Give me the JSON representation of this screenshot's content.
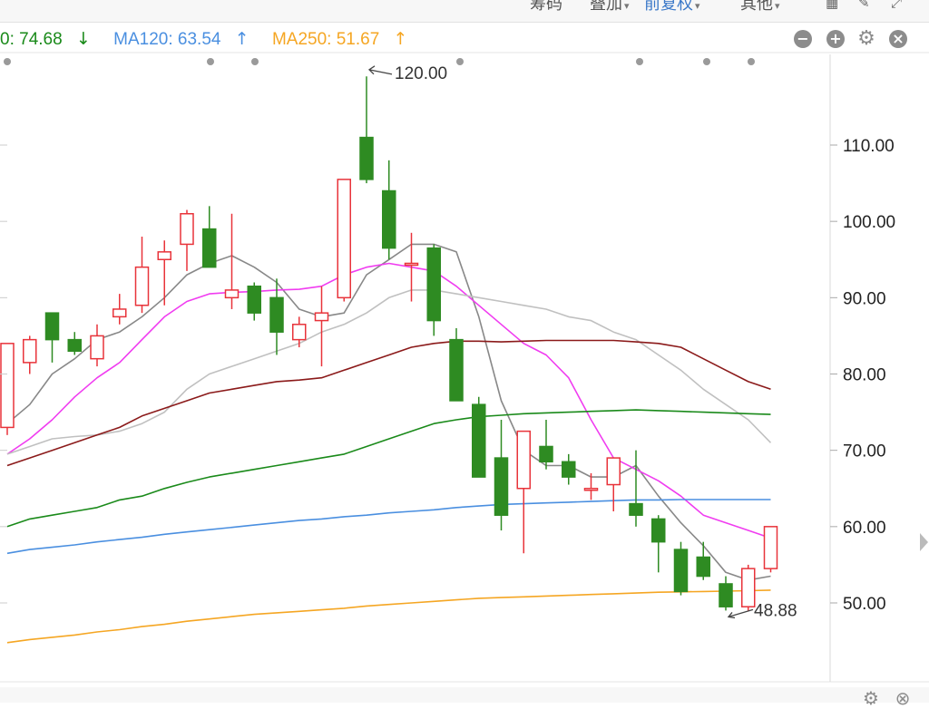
{
  "toolbar": {
    "items": [
      {
        "label": "筹码",
        "caret": false,
        "active": false
      },
      {
        "label": "叠加",
        "caret": true,
        "active": false
      },
      {
        "label": "前复权",
        "caret": true,
        "active": true
      },
      {
        "label": "其他",
        "caret": true,
        "active": false
      }
    ],
    "icons": [
      "layout-icon",
      "pen-icon",
      "fullscreen-icon"
    ]
  },
  "legend": [
    {
      "text": "0: 74.68",
      "arrow": "↓",
      "color": "#1a8a1a"
    },
    {
      "text": "MA120: 63.54",
      "arrow": "↑",
      "color": "#4a8fe0"
    },
    {
      "text": "MA250: 51.67",
      "arrow": "↑",
      "color": "#f5a623"
    }
  ],
  "panel_controls": [
    "minus-icon",
    "plus-icon",
    "gear-icon",
    "close-icon"
  ],
  "colors": {
    "up": "#e8333a",
    "down": "#2e8b22",
    "ma5": "#888888",
    "ma10": "#f03cf0",
    "ma20": "#c0c0c0",
    "ma30": "#8b1a1a",
    "ma60": "#1a8a1a",
    "ma120": "#4a8fe0",
    "ma250": "#f5a623"
  },
  "chart_data": {
    "type": "candlestick",
    "y_ticks": [
      "110.00",
      "100.00",
      "90.00",
      "80.00",
      "70.00",
      "60.00",
      "50.00"
    ],
    "y_tick_values": [
      110,
      100,
      90,
      80,
      70,
      60,
      50
    ],
    "ylim": [
      41,
      126
    ],
    "max_label": "120.00",
    "max_value": 120.0,
    "min_label": "48.88",
    "min_value": 48.88,
    "candles": [
      {
        "o": 73,
        "h": 84,
        "l": 72,
        "c": 84
      },
      {
        "o": 81.5,
        "h": 85,
        "l": 80,
        "c": 84.5
      },
      {
        "o": 88,
        "h": 88,
        "l": 81.5,
        "c": 84.5
      },
      {
        "o": 84.5,
        "h": 85.5,
        "l": 82.5,
        "c": 83
      },
      {
        "o": 82,
        "h": 86.5,
        "l": 81,
        "c": 85
      },
      {
        "o": 87.5,
        "h": 90.5,
        "l": 86.5,
        "c": 88.5
      },
      {
        "o": 89,
        "h": 98,
        "l": 88,
        "c": 94
      },
      {
        "o": 95,
        "h": 97.5,
        "l": 89,
        "c": 96
      },
      {
        "o": 97,
        "h": 101.5,
        "l": 93.5,
        "c": 101
      },
      {
        "o": 99,
        "h": 102,
        "l": 94,
        "c": 94
      },
      {
        "o": 90,
        "h": 101,
        "l": 88.5,
        "c": 91
      },
      {
        "o": 91.5,
        "h": 92,
        "l": 87,
        "c": 88
      },
      {
        "o": 90,
        "h": 92.5,
        "l": 82.5,
        "c": 85.5
      },
      {
        "o": 84.5,
        "h": 87.5,
        "l": 83.5,
        "c": 86.5
      },
      {
        "o": 87,
        "h": 91.5,
        "l": 81,
        "c": 88
      },
      {
        "o": 90,
        "h": 91,
        "l": 89.5,
        "c": 105.5
      },
      {
        "o": 111,
        "h": 119,
        "l": 105,
        "c": 105.5
      },
      {
        "o": 104,
        "h": 108,
        "l": 95,
        "c": 96.5
      },
      {
        "o": 94.5,
        "h": 98.5,
        "l": 89.5,
        "c": 94.5
      },
      {
        "o": 96.5,
        "h": 97,
        "l": 85,
        "c": 87
      },
      {
        "o": 84.5,
        "h": 86,
        "l": 77.5,
        "c": 76.5
      },
      {
        "o": 76,
        "h": 77,
        "l": 66.5,
        "c": 66.5
      },
      {
        "o": 69,
        "h": 74,
        "l": 59.5,
        "c": 61.5
      },
      {
        "o": 65,
        "h": 72.5,
        "l": 56.5,
        "c": 72.5
      },
      {
        "o": 70.5,
        "h": 74,
        "l": 67.5,
        "c": 68.5
      },
      {
        "o": 68.5,
        "h": 69.5,
        "l": 65.5,
        "c": 66.5
      },
      {
        "o": 65,
        "h": 67,
        "l": 63.5,
        "c": 65
      },
      {
        "o": 65.5,
        "h": 69,
        "l": 62,
        "c": 69
      },
      {
        "o": 63,
        "h": 70,
        "l": 60,
        "c": 61.5
      },
      {
        "o": 61,
        "h": 61.5,
        "l": 54,
        "c": 58
      },
      {
        "o": 57,
        "h": 58,
        "l": 51,
        "c": 51.5
      },
      {
        "o": 56,
        "h": 58,
        "l": 53,
        "c": 53.5
      },
      {
        "o": 52.5,
        "h": 53.5,
        "l": 49,
        "c": 49.5
      },
      {
        "o": 49.5,
        "h": 55,
        "l": 49,
        "c": 54.5
      },
      {
        "o": 54.5,
        "h": 60,
        "l": 54,
        "c": 60
      }
    ],
    "ma_lines": [
      {
        "name": "MA5",
        "color_key": "ma5",
        "values": [
          73.5,
          76,
          80,
          82,
          84.5,
          85.5,
          87.5,
          90,
          93,
          94.5,
          95.5,
          94,
          92,
          88.5,
          87.5,
          88,
          93,
          95,
          97,
          97,
          96,
          87.5,
          76.5,
          70,
          68,
          68,
          66.5,
          66.5,
          68,
          64,
          60.5,
          57.5,
          54,
          53,
          53.5
        ]
      },
      {
        "name": "MA10",
        "color_key": "ma10",
        "values": [
          69.5,
          71.5,
          74,
          77,
          79.5,
          81.5,
          84.5,
          87.5,
          89.5,
          90.5,
          90.7,
          90.8,
          91,
          91.1,
          91.5,
          93,
          94,
          94.5,
          94,
          93.5,
          91.5,
          89,
          86.5,
          84,
          82.5,
          79.5,
          74,
          69,
          67.5,
          66,
          64,
          61.5,
          60.5,
          59.5,
          58.5
        ]
      },
      {
        "name": "MA20",
        "color_key": "ma20",
        "values": [
          69.5,
          70.5,
          71.5,
          71.8,
          72,
          72.5,
          73.5,
          75,
          78,
          80,
          81,
          82,
          83,
          84,
          85.5,
          86.5,
          88,
          90,
          91,
          91,
          90.5,
          90,
          89.5,
          89,
          88.5,
          87.5,
          87,
          85.5,
          84.5,
          82.5,
          80.5,
          78,
          76,
          74,
          71
        ]
      },
      {
        "name": "MA30",
        "color_key": "ma30",
        "values": [
          68,
          69,
          70,
          71,
          72,
          73,
          74.5,
          75.5,
          76.5,
          77.5,
          78,
          78.5,
          79,
          79.2,
          79.5,
          80.5,
          81.5,
          82.5,
          83.5,
          84,
          84.3,
          84.3,
          84.2,
          84.3,
          84.4,
          84.4,
          84.4,
          84.4,
          84.2,
          84,
          83.5,
          82,
          80.5,
          79,
          78
        ]
      },
      {
        "name": "MA60",
        "color_key": "ma60",
        "values": [
          60,
          61,
          61.5,
          62,
          62.5,
          63.5,
          64,
          65,
          65.8,
          66.5,
          67,
          67.5,
          68,
          68.5,
          69,
          69.5,
          70.5,
          71.5,
          72.5,
          73.5,
          74,
          74.4,
          74.6,
          74.8,
          74.9,
          75,
          75.1,
          75.2,
          75.3,
          75.2,
          75.1,
          75,
          74.9,
          74.8,
          74.7
        ]
      },
      {
        "name": "MA120",
        "color_key": "ma120",
        "values": [
          56.5,
          57,
          57.3,
          57.6,
          58,
          58.3,
          58.6,
          59,
          59.3,
          59.6,
          59.9,
          60.2,
          60.5,
          60.8,
          61,
          61.3,
          61.5,
          61.8,
          62,
          62.2,
          62.5,
          62.7,
          62.9,
          63,
          63.1,
          63.2,
          63.3,
          63.4,
          63.5,
          63.5,
          63.54,
          63.54,
          63.54,
          63.54,
          63.54
        ]
      },
      {
        "name": "MA250",
        "color_key": "ma250",
        "values": [
          44.8,
          45.2,
          45.5,
          45.8,
          46.2,
          46.5,
          46.9,
          47.2,
          47.6,
          47.9,
          48.2,
          48.5,
          48.7,
          48.9,
          49.1,
          49.3,
          49.6,
          49.8,
          50,
          50.2,
          50.4,
          50.6,
          50.7,
          50.8,
          50.9,
          51,
          51.1,
          51.2,
          51.3,
          51.4,
          51.45,
          51.5,
          51.55,
          51.6,
          51.67
        ]
      }
    ]
  }
}
